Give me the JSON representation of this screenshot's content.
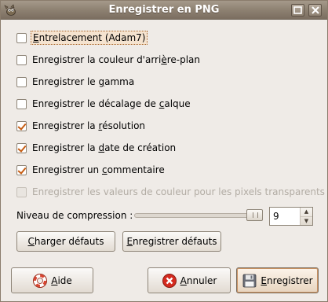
{
  "window": {
    "title": "Enregistrer en PNG"
  },
  "options": [
    {
      "pre": "",
      "mnemonic": "E",
      "post": "ntrelacement (Adam7)",
      "checked": false,
      "disabled": false,
      "focused": true
    },
    {
      "pre": "Enregistrer la couleur d'arri",
      "mnemonic": "è",
      "post": "re-plan",
      "checked": false,
      "disabled": false
    },
    {
      "pre": "Enregistrer le ",
      "mnemonic": "g",
      "post": "amma",
      "checked": false,
      "disabled": false
    },
    {
      "pre": "Enregistrer le décalage de ",
      "mnemonic": "c",
      "post": "alque",
      "checked": false,
      "disabled": false
    },
    {
      "pre": "Enregistrer la ",
      "mnemonic": "r",
      "post": "ésolution",
      "checked": true,
      "disabled": false
    },
    {
      "pre": "Enregistrer la ",
      "mnemonic": "d",
      "post": "ate de création",
      "checked": true,
      "disabled": false
    },
    {
      "pre": "Enregistrer un ",
      "mnemonic": "c",
      "post": "ommentaire",
      "checked": true,
      "disabled": false
    },
    {
      "pre": "Enregistrer les valeurs de couleur pour les pixels transparents",
      "mnemonic": "",
      "post": "",
      "checked": false,
      "disabled": true
    }
  ],
  "compression": {
    "label": "Niveau de compression :",
    "value": "9",
    "level_fraction": 1.0
  },
  "defaults": {
    "load": {
      "mnemonic": "C",
      "rest": "harger défauts"
    },
    "save": {
      "mnemonic": "E",
      "rest": "nregistrer défauts"
    }
  },
  "actions": {
    "help": {
      "mnemonic": "A",
      "rest": "ide"
    },
    "cancel": {
      "mnemonic": "A",
      "rest": "nnuler"
    },
    "save": {
      "mnemonic": "E",
      "rest": "nregistrer"
    }
  },
  "icons": {
    "app": "gimp-wilber-icon",
    "help": "lifebuoy-icon",
    "cancel": "cancel-icon",
    "save": "floppy-disk-icon"
  },
  "colors": {
    "titlebar": "#8c7f70",
    "check": "#c65d13",
    "dialog_bg": "#efebe7"
  }
}
